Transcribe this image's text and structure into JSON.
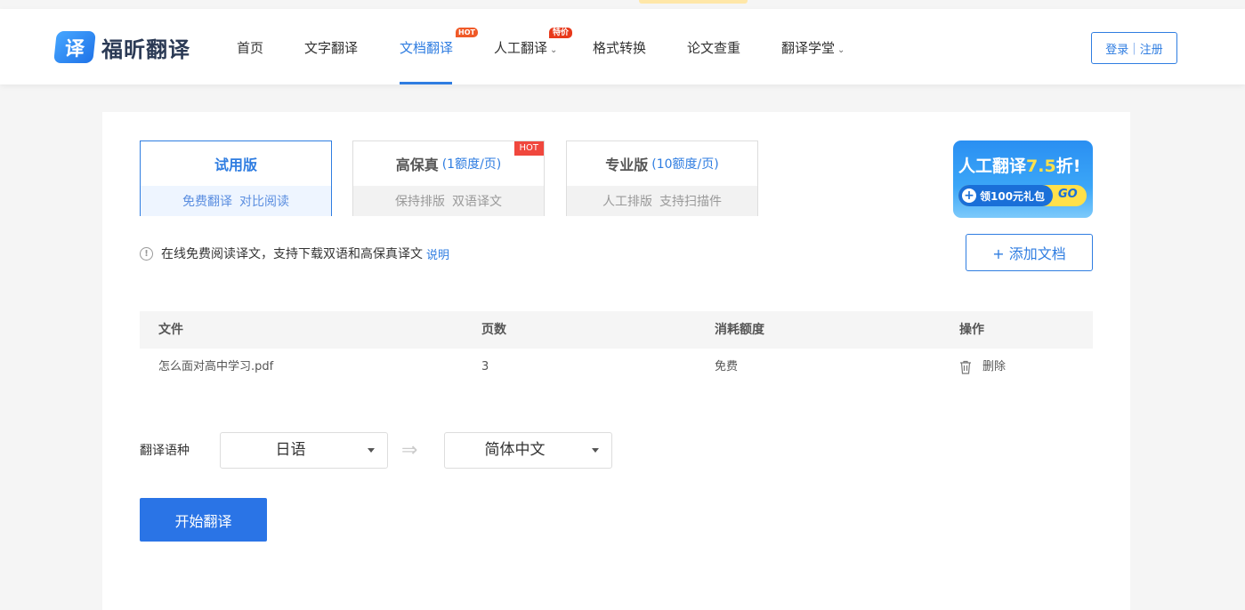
{
  "header": {
    "logo_glyph": "译",
    "logo_text": "福昕翻译",
    "nav": [
      {
        "label": "首页"
      },
      {
        "label": "文字翻译"
      },
      {
        "label": "文档翻译",
        "badge": "HOT",
        "active": true
      },
      {
        "label": "人工翻译",
        "badge": "特价",
        "has_dropdown": true
      },
      {
        "label": "格式转换"
      },
      {
        "label": "论文查重"
      },
      {
        "label": "翻译学堂",
        "has_dropdown": true
      }
    ],
    "login": "登录",
    "login_sep": "|",
    "register": "注册"
  },
  "plans": [
    {
      "name": "试用版",
      "price": "",
      "features": [
        "免费翻译",
        "对比阅读"
      ],
      "selected": true
    },
    {
      "name": "高保真",
      "price": "(1额度/页)",
      "features": [
        "保持排版",
        "双语译文"
      ],
      "badge": "HOT"
    },
    {
      "name": "专业版",
      "price": "(10额度/页)",
      "features": [
        "人工排版",
        "支持扫描件"
      ]
    }
  ],
  "ad": {
    "title_prefix": "人工翻译",
    "title_number": "7.5",
    "title_suffix": "折!",
    "coupon": "领100元礼包",
    "go": "GO"
  },
  "notice": {
    "icon": "!",
    "text": "在线免费阅读译文，支持下载双语和高保真译文",
    "link": "说明"
  },
  "add_document": "+ 添加文档",
  "table": {
    "headers": [
      "文件",
      "页数",
      "消耗额度",
      "操作"
    ],
    "rows": [
      {
        "file": "怎么面对高中学习.pdf",
        "pages": "3",
        "cost": "免费",
        "action": "删除"
      }
    ]
  },
  "language": {
    "label": "翻译语种",
    "source": "日语",
    "target": "简体中文",
    "swap": "⇒"
  },
  "start_button": "开始翻译",
  "colors": {
    "accent": "#2f7de1",
    "button": "#2a74e6",
    "hot": "#f0473d"
  }
}
